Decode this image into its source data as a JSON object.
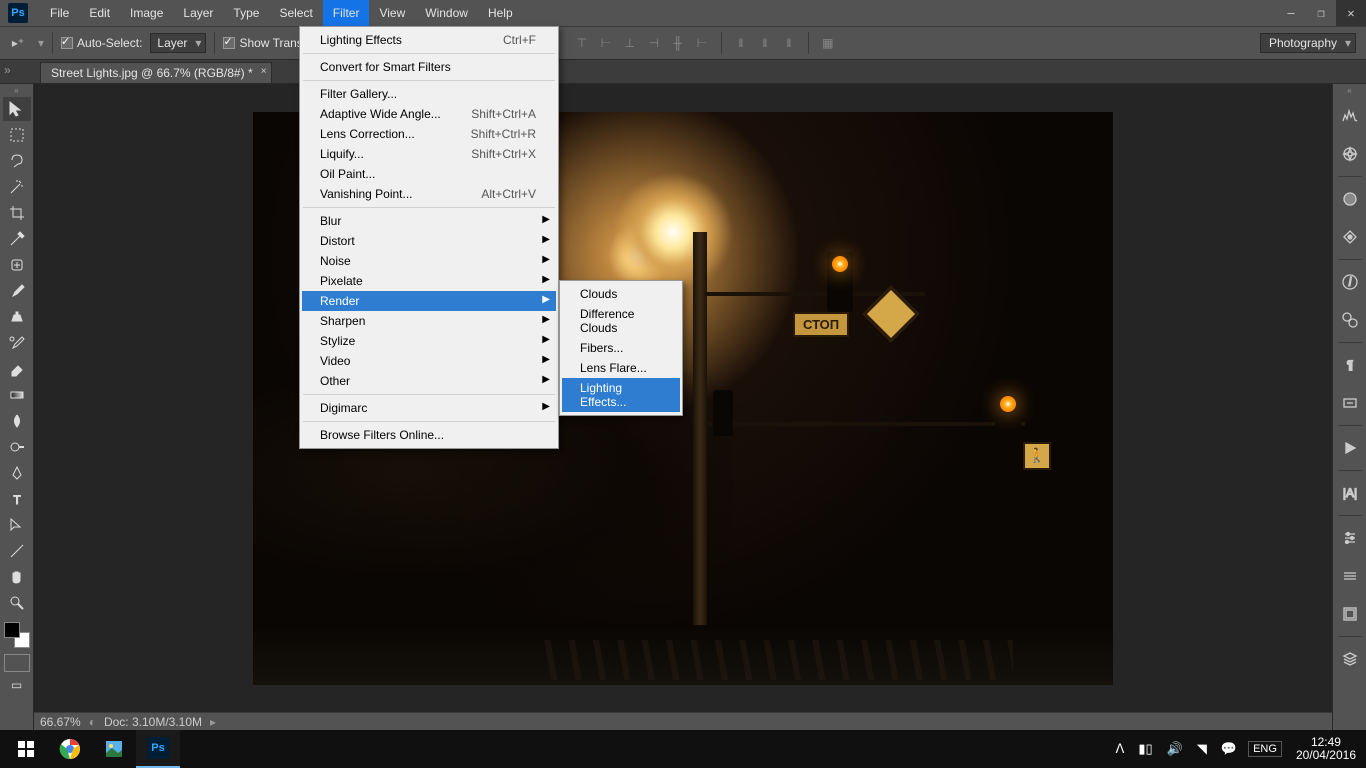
{
  "menubar": {
    "items": [
      "File",
      "Edit",
      "Image",
      "Layer",
      "Type",
      "Select",
      "Filter",
      "View",
      "Window",
      "Help"
    ],
    "active_index": 6
  },
  "options": {
    "auto_select_label": "Auto-Select:",
    "layer_select": "Layer",
    "show_trans_label": "Show Trans",
    "workspace": "Photography"
  },
  "doc_tab": {
    "title": "Street Lights.jpg @ 66.7% (RGB/8#) *"
  },
  "status": {
    "zoom": "66.67%",
    "doc": "Doc: 3.10M/3.10M"
  },
  "canvas": {
    "stop_text": "СТОП"
  },
  "filter_menu": {
    "section1": [
      {
        "label": "Lighting Effects",
        "shortcut": "Ctrl+F"
      },
      {
        "label": "Convert for Smart Filters"
      }
    ],
    "section2": [
      {
        "label": "Filter Gallery..."
      },
      {
        "label": "Adaptive Wide Angle...",
        "shortcut": "Shift+Ctrl+A"
      },
      {
        "label": "Lens Correction...",
        "shortcut": "Shift+Ctrl+R"
      },
      {
        "label": "Liquify...",
        "shortcut": "Shift+Ctrl+X"
      },
      {
        "label": "Oil Paint..."
      },
      {
        "label": "Vanishing Point...",
        "shortcut": "Alt+Ctrl+V"
      }
    ],
    "section3": [
      {
        "label": "Blur",
        "sub": true
      },
      {
        "label": "Distort",
        "sub": true
      },
      {
        "label": "Noise",
        "sub": true
      },
      {
        "label": "Pixelate",
        "sub": true
      },
      {
        "label": "Render",
        "sub": true,
        "highlight": true
      },
      {
        "label": "Sharpen",
        "sub": true
      },
      {
        "label": "Stylize",
        "sub": true
      },
      {
        "label": "Video",
        "sub": true
      },
      {
        "label": "Other",
        "sub": true
      }
    ],
    "section4": [
      {
        "label": "Digimarc",
        "sub": true
      }
    ],
    "section5": [
      {
        "label": "Browse Filters Online..."
      }
    ]
  },
  "render_menu": {
    "items": [
      {
        "label": "Clouds"
      },
      {
        "label": "Difference Clouds"
      },
      {
        "label": "Fibers..."
      },
      {
        "label": "Lens Flare..."
      },
      {
        "label": "Lighting Effects...",
        "highlight": true
      }
    ]
  },
  "taskbar": {
    "lang": "ENG",
    "time": "12:49",
    "date": "20/04/2016"
  }
}
